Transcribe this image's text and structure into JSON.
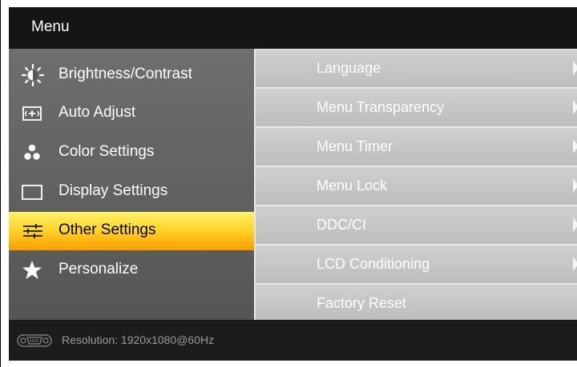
{
  "menu": {
    "title": "Menu"
  },
  "sidebar": {
    "items": [
      {
        "label": "Brightness/Contrast",
        "icon": "brightness-icon",
        "active": false
      },
      {
        "label": "Auto Adjust",
        "icon": "auto-adjust-icon",
        "active": false
      },
      {
        "label": "Color Settings",
        "icon": "color-settings-icon",
        "active": false
      },
      {
        "label": "Display Settings",
        "icon": "display-settings-icon",
        "active": false
      },
      {
        "label": "Other Settings",
        "icon": "sliders-icon",
        "active": true
      },
      {
        "label": "Personalize",
        "icon": "star-icon",
        "active": false
      }
    ]
  },
  "submenu": {
    "items": [
      {
        "label": "Language",
        "has_arrow": true
      },
      {
        "label": "Menu Transparency",
        "has_arrow": true
      },
      {
        "label": "Menu Timer",
        "has_arrow": true
      },
      {
        "label": "Menu Lock",
        "has_arrow": true
      },
      {
        "label": "DDC/CI",
        "has_arrow": true
      },
      {
        "label": "LCD Conditioning",
        "has_arrow": true
      },
      {
        "label": "Factory Reset",
        "has_arrow": false
      }
    ]
  },
  "footer": {
    "resolution": "Resolution: 1920x1080@60Hz",
    "icon": "vga-connector-icon"
  },
  "colors": {
    "active_top": "#fff26a",
    "active_bottom": "#ff9c00",
    "panel_row": "#c8c8c8",
    "sidebar": "#626262"
  }
}
